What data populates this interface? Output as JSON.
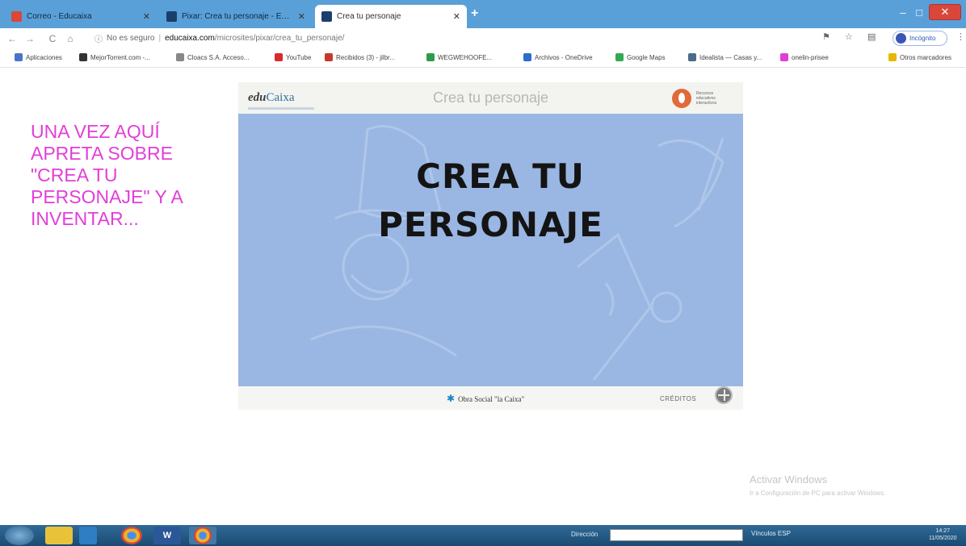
{
  "browser": {
    "tabs": [
      {
        "title": "Correo - Educaixa",
        "active": false,
        "favicon_color": "#d9473a"
      },
      {
        "title": "Pixar: Crea tu personaje - EduCaixa",
        "active": false,
        "favicon_color": "#1b3f6b"
      },
      {
        "title": "Crea tu personaje",
        "active": true,
        "favicon_color": "#1b3f6b"
      }
    ],
    "new_tab": "+",
    "window_controls": {
      "minimize": "–",
      "maximize": "□",
      "close": "✕"
    },
    "nav": {
      "back": "←",
      "forward": "→",
      "reload": "C",
      "home": "⌂"
    },
    "url": {
      "security_label": "No es seguro",
      "domain": "educaixa.com",
      "path": "/microsites/pixar/crea_tu_personaje/"
    },
    "profile_label": "Incógnito"
  },
  "bookmarks": [
    {
      "label": "Aplicaciones",
      "color": "#4a74c9"
    },
    {
      "label": "MejorTorrent.com -...",
      "color": "#333333"
    },
    {
      "label": "Cloacs S.A. Acceso...",
      "color": "#888888"
    },
    {
      "label": "YouTube",
      "color": "#d62b2b"
    },
    {
      "label": "Recibidos (3) - jilbr...",
      "color": "#c53929"
    },
    {
      "label": "WEGWEHOOFE...",
      "color": "#2f9c4a"
    },
    {
      "label": "Archivos - OneDrive",
      "color": "#2a6ccf"
    },
    {
      "label": "Google Maps",
      "color": "#35a853"
    },
    {
      "label": "Idealista — Casas y...",
      "color": "#4a6b8a"
    },
    {
      "label": "onelin-prisee",
      "color": "#e03fd3"
    },
    {
      "label": "Otros marcadores",
      "color": "#e6b800"
    }
  ],
  "instruction": "UNA VEZ AQUÍ\nAPRETA SOBRE\n\"CREA TU\nPERSONAJE\" Y A\nINVENTAR...",
  "app": {
    "logo_prefix": "edu",
    "logo_brand": "Caixa",
    "header_title": "Crea tu personaje",
    "partner_text": "Recursos educativos interactivos",
    "stage_title_line1": "CREA TU",
    "stage_title_line2": "PERSONAJE",
    "sponsor": "Obra Social \"la Caixa\"",
    "credits": "CRÉDITOS",
    "help_icon": "help-icon",
    "colors": {
      "stage": "#9ab7e3",
      "title": "#e23ed8"
    }
  },
  "watermark": {
    "title": "Activar Windows",
    "subtitle": "Ir a Configuración de PC para activar Windows."
  },
  "taskbar": {
    "address_label": "Dirección",
    "tray_text": "Vínculos  ESP",
    "time": "14:27",
    "date": "11/05/2020"
  }
}
